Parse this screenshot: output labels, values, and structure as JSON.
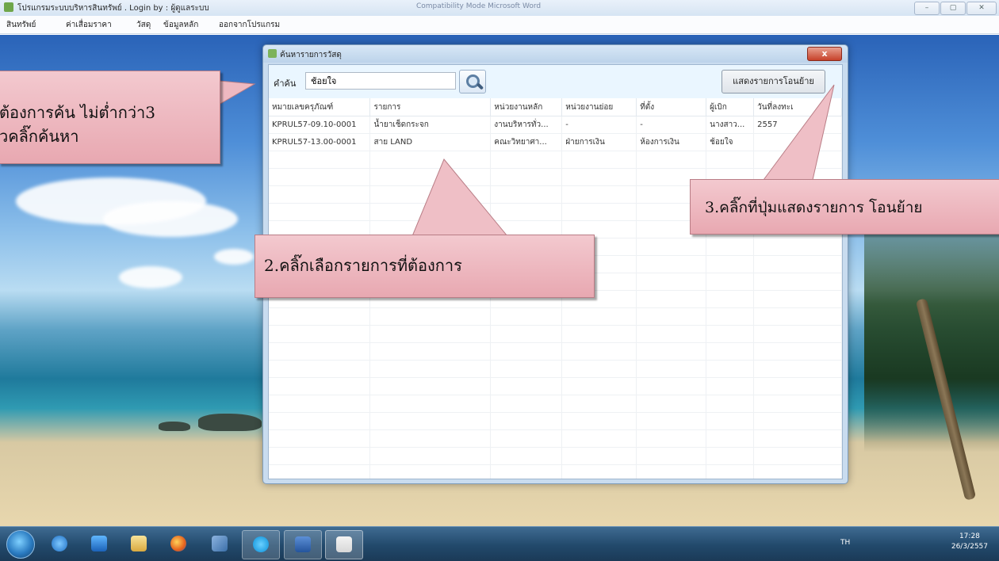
{
  "app": {
    "title": "โปรแกรมระบบบริหารสินทรัพย์ . Login by : ผู้ดูแลระบบ",
    "center_title": "Compatibility Mode  Microsoft Word",
    "controls": [
      "–",
      "▢",
      "✕"
    ]
  },
  "menu": [
    "สินทรัพย์",
    "ค่าเสื่อมราคา",
    "วัสดุ",
    "ข้อมูลหลัก",
    "ออกจากโปรแกรม"
  ],
  "dialog": {
    "title": "ค้นหารายการวัสดุ",
    "close": "x",
    "search_label": "คำค้น",
    "search_value": "ช้อยใจ",
    "show_button": "แสดงรายการโอนย้าย",
    "columns": [
      "หมายเลขครุภัณฑ์",
      "รายการ",
      "หน่วยงานหลัก",
      "หน่วยงานย่อย",
      "ที่ตั้ง",
      "ผู้เบิก",
      "วันที่ลงทะเ"
    ],
    "rows": [
      [
        "KPRUL57-09.10-0001",
        "น้ำยาเช็ดกระจก",
        "งานบริหารทั่ว...",
        "-",
        "-",
        "นางสาว...",
        "2557"
      ],
      [
        "KPRUL57-13.00-0001",
        "สาย LAND",
        "คณะวิทยาศา...",
        "ฝ่ายการเงิน",
        "ห้องการเงิน",
        "ช้อยใจ",
        ""
      ]
    ]
  },
  "callouts": {
    "step1_line1": "ต้องการค้น ไม่ต่ำกว่า3",
    "step1_line2": "วคลิ๊กค้นหา",
    "step2": "2.คลิ๊กเลือกรายการที่ต้องการ",
    "step3": "3.คลิ๊กที่ปุ่มแสดงรายการ โอนย้าย"
  },
  "taskbar": {
    "language": "TH",
    "time": "17:28",
    "date": "26/3/2557",
    "items": [
      "internet-explorer-icon",
      "media-player-icon",
      "file-explorer-icon",
      "firefox-icon",
      "bowtie-app-icon",
      "skype-icon",
      "word-icon",
      "acrobat-icon"
    ]
  }
}
